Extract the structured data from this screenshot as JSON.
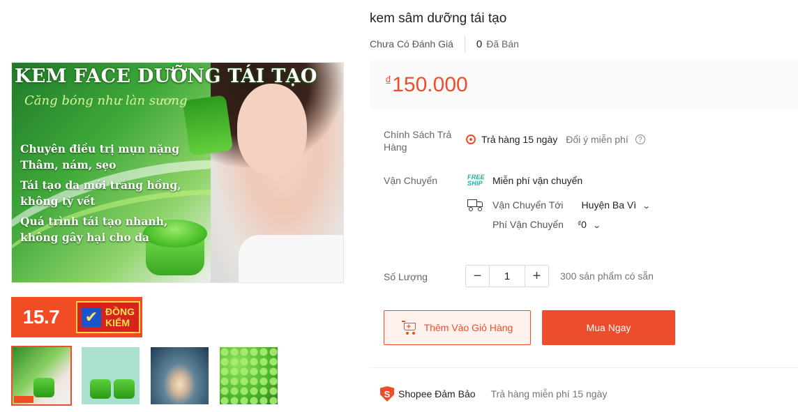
{
  "product": {
    "title": "kem sâm dưỡng tái tạo",
    "rating_text": "Chưa Có Đánh Giá",
    "sold_count": "0",
    "sold_label": "Đã Bán",
    "currency_symbol": "₫",
    "price": "150.000"
  },
  "gallery": {
    "main_image": {
      "headline": "KEM FACE DƯỠNG TÁI TẠO",
      "tagline": "Căng bóng như làn sương",
      "claims": [
        "Chuyên điều trị mụn nặng Thâm, nám, sẹo",
        "Tái tạo da mới trắng hồng, không tỳ vết",
        "Quá trình tái tạo nhanh, không gây hại cho da"
      ]
    },
    "promo_banner": {
      "date": "15.7",
      "badge_text": "ĐỒNG\nKIỂM",
      "check_icon": "check-icon"
    },
    "thumbnails": [
      {
        "label": "thumbnail-1",
        "active": true
      },
      {
        "label": "thumbnail-2",
        "active": false
      },
      {
        "label": "thumbnail-3",
        "active": false
      },
      {
        "label": "thumbnail-4",
        "active": false
      }
    ]
  },
  "policy": {
    "label": "Chính Sách Trả Hàng",
    "return_days": "Trả hàng 15 ngày",
    "free_change": "Đổi ý miễn phí",
    "help_icon": "question-icon"
  },
  "shipping": {
    "label": "Vận Chuyển",
    "freeship_logo": [
      "FREE",
      "SHIP"
    ],
    "freeship_text": "Miễn phí vận chuyển",
    "ship_to_label": "Vận Chuyển Tới",
    "ship_to_value": "Huyện Ba Vì",
    "fee_label": "Phí Vận Chuyển",
    "fee_currency": "₫",
    "fee_value": "0"
  },
  "quantity": {
    "label": "Số Lượng",
    "minus": "−",
    "value": "1",
    "plus": "+",
    "stock": "300 sản phẩm có sẵn"
  },
  "actions": {
    "add_to_cart": "Thêm Vào Giỏ Hàng",
    "buy_now": "Mua Ngay"
  },
  "guarantee": {
    "name": "Shopee Đảm Bảo",
    "description": "Trả hàng miễn phí 15 ngày"
  },
  "colors": {
    "accent": "#ee4d2d",
    "price_bg": "#fafafa",
    "freeship": "#26aa99"
  }
}
